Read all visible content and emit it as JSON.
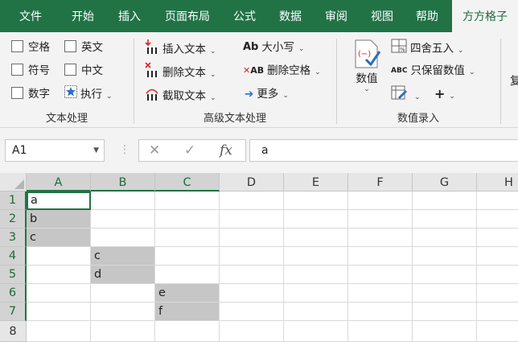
{
  "tabs": [
    "文件",
    "开始",
    "插入",
    "页面布局",
    "公式",
    "数据",
    "审阅",
    "视图",
    "帮助",
    "方方格子"
  ],
  "active_tab": "方方格子",
  "ribbon": {
    "text_group": {
      "label": "文本处理",
      "checkboxes": [
        "空格",
        "英文",
        "符号",
        "中文",
        "数字"
      ],
      "execute": "执行"
    },
    "adv_group": {
      "label": "高级文本处理",
      "insert_text": "插入文本",
      "delete_text": "删除文本",
      "extract_text": "截取文本",
      "case": "大小写",
      "delete_space": "删除空格",
      "more": "更多"
    },
    "num_group": {
      "label": "数值录入",
      "value": "数值",
      "round": "四舍五入",
      "keep_value": "只保留数值",
      "plus": "+"
    },
    "cut_text": "复"
  },
  "formula_bar": {
    "name_box": "A1",
    "cancel": "✕",
    "confirm": "✓",
    "fx": "fx",
    "content": "a"
  },
  "columns": [
    "A",
    "B",
    "C",
    "D",
    "E",
    "F",
    "G",
    "H"
  ],
  "rows": [
    "1",
    "2",
    "3",
    "4",
    "5",
    "6",
    "7",
    "8"
  ],
  "cells": {
    "A1": "a",
    "A2": "b",
    "A3": "c",
    "B4": "c",
    "B5": "d",
    "C6": "e",
    "C7": "f"
  }
}
